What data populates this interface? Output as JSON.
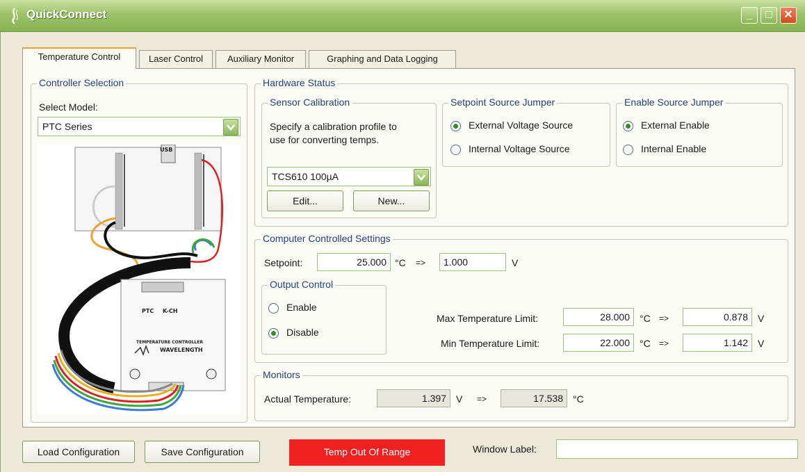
{
  "window": {
    "title": "QuickConnect"
  },
  "tabs": [
    "Temperature Control",
    "Laser Control",
    "Auxiliary Monitor",
    "Graphing and Data Logging"
  ],
  "controller_selection": {
    "title": "Controller Selection",
    "select_model_label": "Select Model:",
    "model_value": "PTC Series",
    "image_labels": {
      "usb": "USB",
      "ptc": "PTC",
      "kch": "K-CH",
      "brand_line1": "TEMPERATURE CONTROLLER",
      "brand_line2": "WAVELENGTH"
    }
  },
  "hardware_status": {
    "title": "Hardware Status",
    "sensor_calibration": {
      "title": "Sensor Calibration",
      "description_line1": "Specify a calibration profile to",
      "description_line2": "use for converting temps.",
      "profile_value": "TCS610 100µA",
      "edit_label": "Edit...",
      "new_label": "New..."
    },
    "setpoint_source_jumper": {
      "title": "Setpoint Source Jumper",
      "options": [
        "External Voltage Source",
        "Internal Voltage Source"
      ],
      "selected": 0
    },
    "enable_source_jumper": {
      "title": "Enable Source Jumper",
      "options": [
        "External Enable",
        "Internal Enable"
      ],
      "selected": 0
    }
  },
  "computer_controlled_settings": {
    "title": "Computer Controlled Settings",
    "setpoint_label": "Setpoint:",
    "setpoint_value": "25.000",
    "setpoint_unit": "°C",
    "arrow": "=>",
    "setpoint_voltage": "1.000",
    "voltage_unit": "V",
    "output_control": {
      "title": "Output Control",
      "options": [
        "Enable",
        "Disable"
      ],
      "selected": 1
    },
    "max_temp_label": "Max Temperature Limit:",
    "max_temp_value": "28.000",
    "max_temp_voltage": "0.878",
    "min_temp_label": "Min Temperature Limit:",
    "min_temp_value": "22.000",
    "min_temp_voltage": "1.142",
    "temp_unit": "°C"
  },
  "monitors": {
    "title": "Monitors",
    "actual_temp_label": "Actual Temperature:",
    "actual_voltage": "1.397",
    "voltage_unit": "V",
    "arrow": "=>",
    "actual_temp": "17.538",
    "temp_unit": "°C"
  },
  "footer": {
    "load_label": "Load Configuration",
    "save_label": "Save Configuration",
    "status_text": "Temp Out Of Range",
    "window_label_label": "Window Label:",
    "window_label_value": ""
  },
  "colors": {
    "titlebar": "#9cc26a",
    "status_error": "#ee2020",
    "group_title": "#26437a",
    "accent_tab": "#e8a430"
  }
}
